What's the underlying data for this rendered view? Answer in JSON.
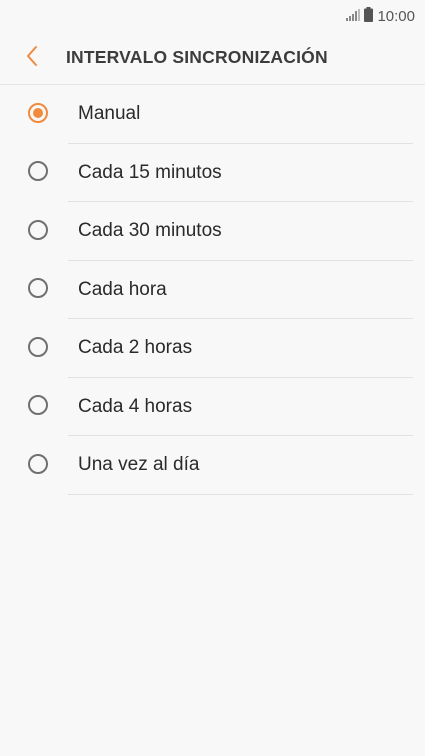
{
  "status_bar": {
    "time": "10:00",
    "signal_icon": "signal-icon",
    "battery_icon": "battery-icon"
  },
  "header": {
    "back_icon": "chevron-left-icon",
    "title": "INTERVALO SINCRONIZACIÓN"
  },
  "colors": {
    "accent": "#f08a3c",
    "background": "#f8f8f8"
  },
  "options": [
    {
      "label": "Manual",
      "selected": true
    },
    {
      "label": "Cada 15 minutos",
      "selected": false
    },
    {
      "label": "Cada 30 minutos",
      "selected": false
    },
    {
      "label": "Cada hora",
      "selected": false
    },
    {
      "label": "Cada 2 horas",
      "selected": false
    },
    {
      "label": "Cada 4 horas",
      "selected": false
    },
    {
      "label": "Una vez al día",
      "selected": false
    }
  ]
}
